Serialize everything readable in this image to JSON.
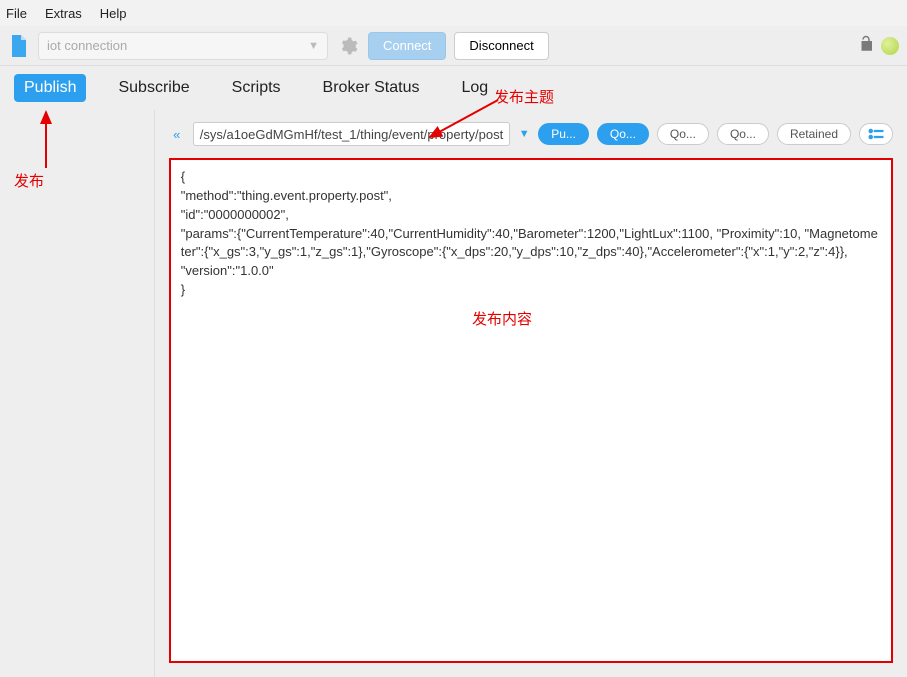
{
  "menu": {
    "file": "File",
    "extras": "Extras",
    "help": "Help"
  },
  "toolbar": {
    "connection_placeholder": "iot connection",
    "connect": "Connect",
    "disconnect": "Disconnect"
  },
  "tabs": {
    "publish": "Publish",
    "subscribe": "Subscribe",
    "scripts": "Scripts",
    "broker": "Broker Status",
    "log": "Log"
  },
  "topic": {
    "value": "/sys/a1oeGdMGmHf/test_1/thing/event/property/post",
    "publish_btn": "Pu...",
    "qos_btn1": "Qo...",
    "qos_btn2": "Qo...",
    "qos_btn3": "Qo...",
    "retained": "Retained"
  },
  "payload": {
    "l1": "{",
    "l2": "\"method\":\"thing.event.property.post\",",
    "l3": "\"id\":\"0000000002\",",
    "l4": "\"params\":{\"CurrentTemperature\":40,\"CurrentHumidity\":40,\"Barometer\":1200,\"LightLux\":1100, \"Proximity\":10, \"Magnetometer\":{\"x_gs\":3,\"y_gs\":1,\"z_gs\":1},\"Gyroscope\":{\"x_dps\":20,\"y_dps\":10,\"z_dps\":40},\"Accelerometer\":{\"x\":1,\"y\":2,\"z\":4}},",
    "l5": "\"version\":\"1.0.0\"",
    "l6": "}"
  },
  "annotations": {
    "topic": "发布主题",
    "content": "发布内容",
    "publish": "发布"
  }
}
